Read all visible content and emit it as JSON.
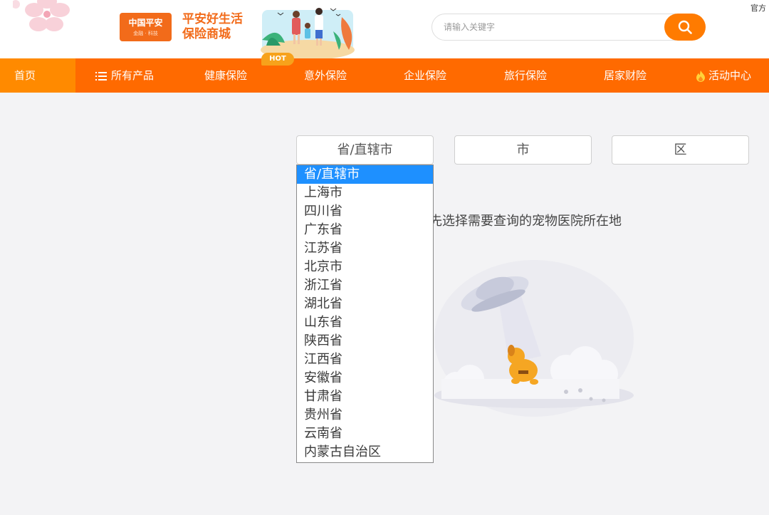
{
  "header": {
    "logo_main": "中国平安",
    "logo_sub": "金融 · 科技",
    "slogan_line1": "平安好生活",
    "slogan_line2": "保险商城",
    "hot_badge": "HOT",
    "search_placeholder": "请输入关键字",
    "top_right_link": "官方"
  },
  "nav": {
    "items": [
      {
        "label": "首页"
      },
      {
        "label": "所有产品",
        "icon": "list-icon"
      },
      {
        "label": "健康保险"
      },
      {
        "label": "意外保险"
      },
      {
        "label": "企业保险"
      },
      {
        "label": "旅行保险"
      },
      {
        "label": "居家财险"
      },
      {
        "label": "活动中心",
        "icon": "flame-icon"
      }
    ]
  },
  "filters": {
    "province": "省/直辖市",
    "city": "市",
    "district": "区"
  },
  "dropdown": {
    "options": [
      "省/直辖市",
      "上海市",
      "四川省",
      "广东省",
      "江苏省",
      "北京市",
      "浙江省",
      "湖北省",
      "山东省",
      "陕西省",
      "江西省",
      "安徽省",
      "甘肃省",
      "贵州省",
      "云南省",
      "内蒙古自治区"
    ],
    "selected_index": 0
  },
  "empty_state": {
    "hint": "先选择需要查询的宠物医院所在地"
  },
  "colors": {
    "brand_orange": "#ff6a00",
    "nav_home_bg": "#ff8a00",
    "selected_option_bg": "#1e90ff"
  }
}
